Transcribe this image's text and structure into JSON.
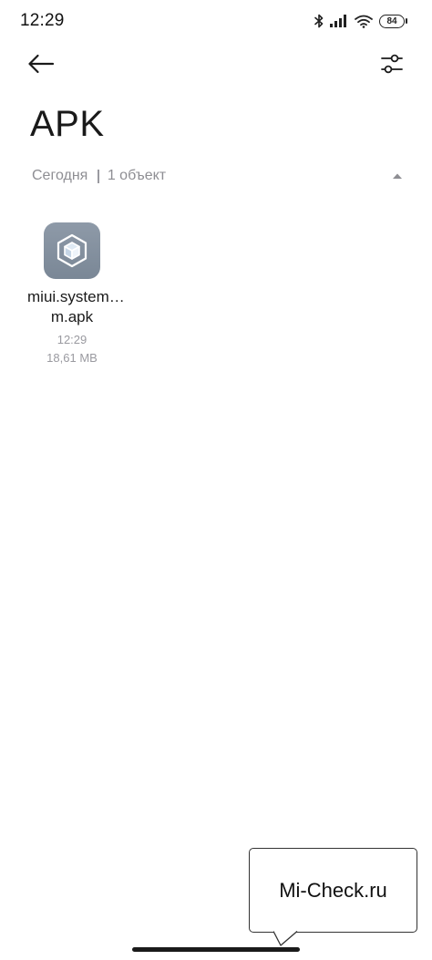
{
  "status_bar": {
    "time": "12:29",
    "battery_level": "84",
    "icons": [
      "bluetooth-icon",
      "signal-icon",
      "wifi-icon",
      "battery-icon"
    ]
  },
  "toolbar": {
    "back_icon": "arrow-left-icon",
    "filter_icon": "sliders-icon"
  },
  "page": {
    "title": "APK"
  },
  "section": {
    "date": "Сегодня",
    "count": "1 объект",
    "collapse_icon": "triangle-up-icon"
  },
  "files": [
    {
      "name": "miui.system…m.apk",
      "time": "12:29",
      "size": "18,61 MB",
      "icon": "package-cube-icon"
    }
  ],
  "watermark": {
    "text": "Mi-Check.ru"
  },
  "colors": {
    "background": "#ffffff",
    "secondary_text": "#8e8e93",
    "file_icon_bg": "#8694a3"
  }
}
